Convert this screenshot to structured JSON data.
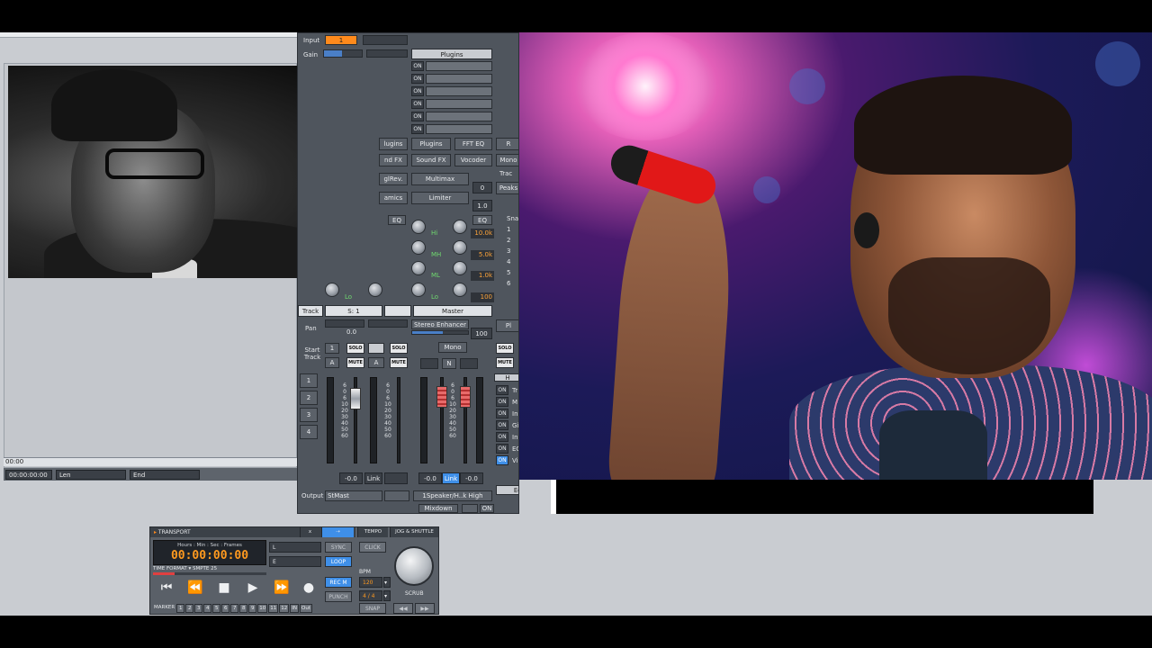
{
  "video": {
    "timeline_time": "00:00",
    "timecode": "00:00:00:00",
    "len_label": "Len",
    "end_label": "End"
  },
  "mixer": {
    "input_label": "Input",
    "input_value": "1",
    "gain_label": "Gain",
    "plugins_header": "Plugins",
    "on": "ON",
    "fx_col1": [
      "lugins",
      "nd FX",
      "glRev.",
      "amics"
    ],
    "fx_col2": [
      "Plugins",
      "Sound FX",
      "Multimax",
      "Limiter"
    ],
    "fx_col3": [
      "FFT EQ",
      "Vocoder"
    ],
    "right_labels": [
      "Mono",
      "Trac",
      "Peaks",
      "Snap"
    ],
    "eq_label": "EQ",
    "eq_bands": [
      "Hi",
      "MH",
      "ML",
      "Lo"
    ],
    "eq_values": [
      "10.0k",
      "5.0k",
      "1.0k",
      "100"
    ],
    "small_values": [
      "0",
      "1.0"
    ],
    "snap_numbers": [
      "1",
      "2",
      "3",
      "4",
      "5",
      "6"
    ],
    "track_label": "Track",
    "track_name": "S: 1",
    "master_label": "Master",
    "pan_label": "Pan",
    "pan_value": "0.0",
    "stereo_enhancer": "Stereo Enhancer",
    "stereo_value": "100",
    "start_track": "Start\nTrack",
    "track_numbers": [
      "1",
      "2",
      "3",
      "4"
    ],
    "solo": "SOLO",
    "mute": "MUTE",
    "mono": "Mono",
    "n_label": "N",
    "a_label": "A",
    "one_label": "1",
    "fader_scale": [
      "6",
      "0",
      "6",
      "10",
      "20",
      "30",
      "40",
      "50",
      "60"
    ],
    "fader_value": "-0.0",
    "link": "Link",
    "output_label": "Output",
    "output_value": "StMast",
    "speaker": "1Speaker/H..k High",
    "mixdown": "Mixdown",
    "edit_label": "Edit...",
    "rack_labels": [
      "Tr",
      "M",
      "In",
      "Gi",
      "In",
      "EC",
      "Vi"
    ],
    "r_label": "R",
    "h_label": "H",
    "ph_label": "Pl"
  },
  "transport": {
    "title": "TRANSPORT",
    "tempo_tab": "TEMPO",
    "jog_tab": "JOG & SHUTTLE",
    "clock_header": "Hours : Min : Sec : Frames",
    "time": "00:00:00:00",
    "time_format_label": "TIME FORMAT",
    "time_format_value": "SMPTE 25",
    "l_label": "L",
    "e_label": "E",
    "sync": "SYNC",
    "loop": "LOOP",
    "rec_m": "REC M",
    "punch": "PUNCH",
    "click": "CLICK",
    "bpm_label": "BPM",
    "bpm_value": "120",
    "signature": "4 / 4",
    "snap": "SNAP",
    "scrub": "SCRUB",
    "marker_label": "MARKER",
    "markers": [
      "1",
      "2",
      "3",
      "4",
      "5",
      "6",
      "7",
      "8",
      "9",
      "10",
      "11",
      "12"
    ],
    "in_label": "IN",
    "out_label": "Out",
    "x_label": "x"
  },
  "colors": {
    "accent_orange": "#ff8a1c",
    "accent_blue": "#3f8fe8",
    "eq_green": "#6fd86f"
  }
}
